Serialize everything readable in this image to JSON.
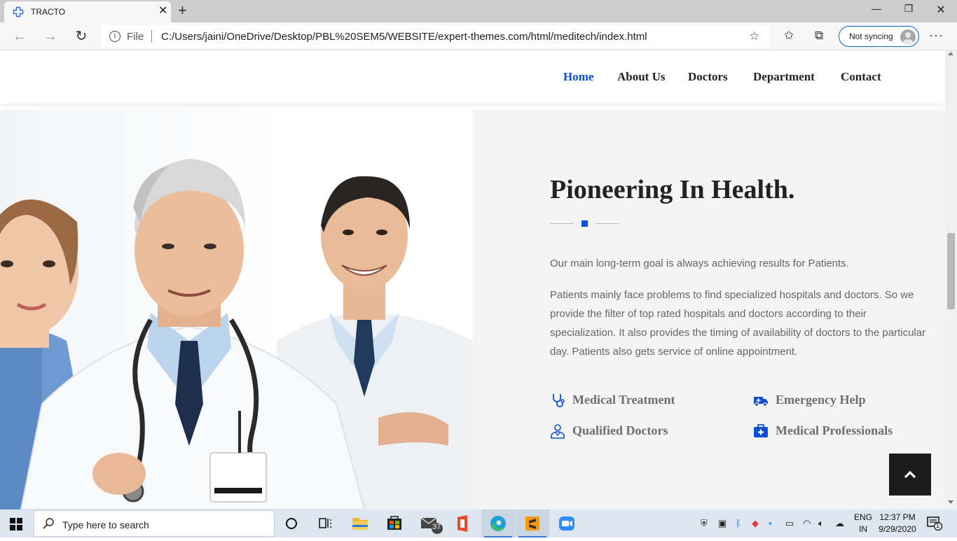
{
  "browser": {
    "tab_title": "TRACTO",
    "url_scheme": "File",
    "url": "C:/Users/jaini/OneDrive/Desktop/PBL%20SEM5/WEBSITE/expert-themes.com/html/meditech/index.html",
    "sync_label": "Not syncing"
  },
  "nav": {
    "items": [
      {
        "label": "Home"
      },
      {
        "label": "About Us"
      },
      {
        "label": "Doctors"
      },
      {
        "label": "Department"
      },
      {
        "label": "Contact"
      }
    ]
  },
  "hero": {
    "headline": "Pioneering In Health.",
    "paragraph1": "Our main long-term goal is always achieving results for Patients.",
    "paragraph2": "Patients mainly face problems to find specialized hospitals and doctors. So we provide the filter of top rated hospitals and doctors according to their specialization. It also provides the timing of availability of doctors to the particular day. Patients also gets service of online appointment.",
    "features": [
      {
        "label": "Medical Treatment",
        "icon": "stethoscope-icon"
      },
      {
        "label": "Emergency Help",
        "icon": "ambulance-icon"
      },
      {
        "label": "Qualified Doctors",
        "icon": "doctor-icon"
      },
      {
        "label": "Medical Professionals",
        "icon": "first-aid-kit-icon"
      }
    ]
  },
  "taskbar": {
    "search_placeholder": "Type here to search",
    "mail_badge": "37",
    "language_line1": "ENG",
    "language_line2": "IN",
    "time": "12:37 PM",
    "date": "9/29/2020",
    "notification_count": "1"
  },
  "colors": {
    "accent": "#0a4fd6",
    "heading": "#222222",
    "body_text": "#666666",
    "feature_text": "#6e6e6e",
    "panel_bg": "#f4f4f4"
  }
}
